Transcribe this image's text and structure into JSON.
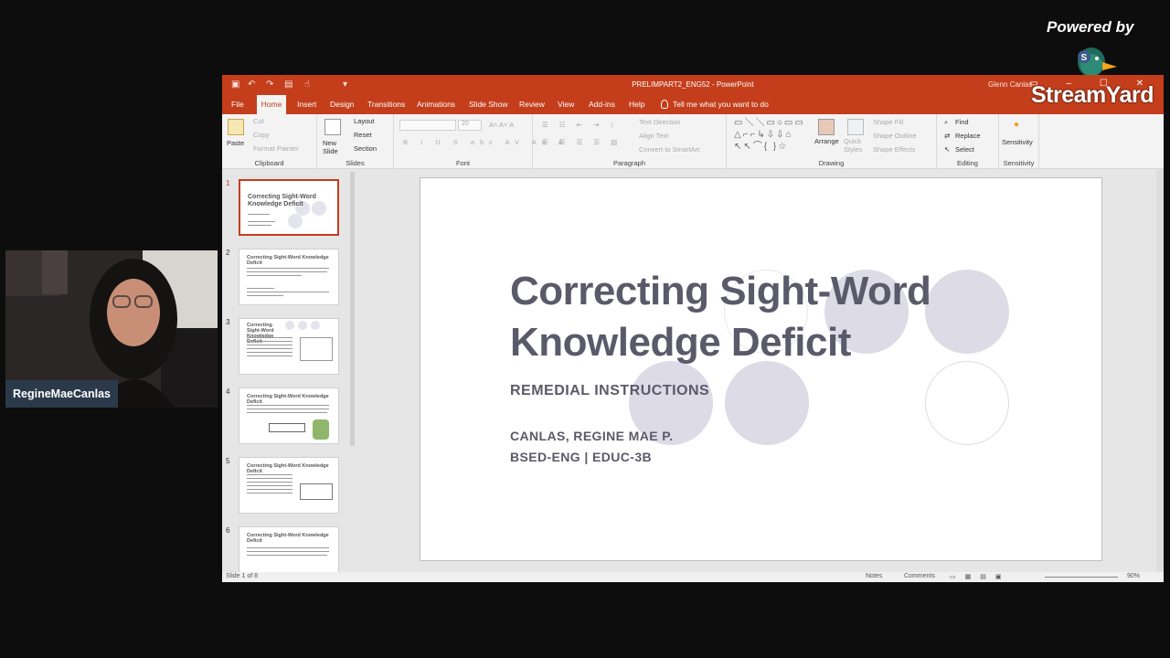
{
  "branding": {
    "powered_by": "Powered by",
    "logo": "StreamYard"
  },
  "camera": {
    "participant_name": "RegineMaeCanlas"
  },
  "window": {
    "title": "PRELIMPART2_ENG52  -  PowerPoint",
    "user": "Glenn Canlas"
  },
  "tabs": [
    "File",
    "Home",
    "Insert",
    "Design",
    "Transitions",
    "Animations",
    "Slide Show",
    "Review",
    "View",
    "Add-ins",
    "Help"
  ],
  "tell_me": "Tell me what you want to do",
  "ribbon": {
    "clipboard": {
      "label": "Clipboard",
      "paste": "Paste",
      "cut": "Cut",
      "copy": "Copy",
      "format_painter": "Format Painter"
    },
    "slides": {
      "label": "Slides",
      "new_slide": "New Slide",
      "layout": "Layout",
      "reset": "Reset",
      "section": "Section"
    },
    "font": {
      "label": "Font",
      "size": "20"
    },
    "paragraph": {
      "label": "Paragraph",
      "text_direction": "Text Direction",
      "align_text": "Align Text",
      "convert": "Convert to SmartArt"
    },
    "drawing": {
      "label": "Drawing",
      "arrange": "Arrange",
      "quick_styles": "Quick Styles",
      "shape_fill": "Shape Fill",
      "shape_outline": "Shape Outline",
      "shape_effects": "Shape Effects"
    },
    "editing": {
      "label": "Editing",
      "find": "Find",
      "replace": "Replace",
      "select": "Select"
    },
    "sensitivity": {
      "label": "Sensitivity",
      "button": "Sensitivity"
    }
  },
  "thumbnails": [
    {
      "num": "1",
      "title": "Correcting Sight-Word Knowledge Deficit"
    },
    {
      "num": "2",
      "title": "Correcting Sight-Word Knowledge Deficit"
    },
    {
      "num": "3",
      "title": "Correcting Sight-Word Knowledge Deficit"
    },
    {
      "num": "4",
      "title": "Correcting Sight-Word Knowledge Deficit"
    },
    {
      "num": "5",
      "title": "Correcting Sight-Word Knowledge Deficit"
    },
    {
      "num": "6",
      "title": "Correcting Sight-Word Knowledge Deficit"
    }
  ],
  "slide": {
    "title_line1": "Correcting Sight-Word",
    "title_line2": "Knowledge Deficit",
    "subtitle": "REMEDIAL INSTRUCTIONS",
    "author": "CANLAS, REGINE MAE P.",
    "course": "BSED-ENG | EDUC-3B"
  },
  "status": {
    "slide_count": "Slide 1 of 8",
    "notes": "Notes",
    "comments": "Comments",
    "zoom": "90%"
  },
  "colors": {
    "accent": "#c43e1c",
    "slide_text": "#5b5a6a",
    "circle": "#dcdbe6"
  }
}
